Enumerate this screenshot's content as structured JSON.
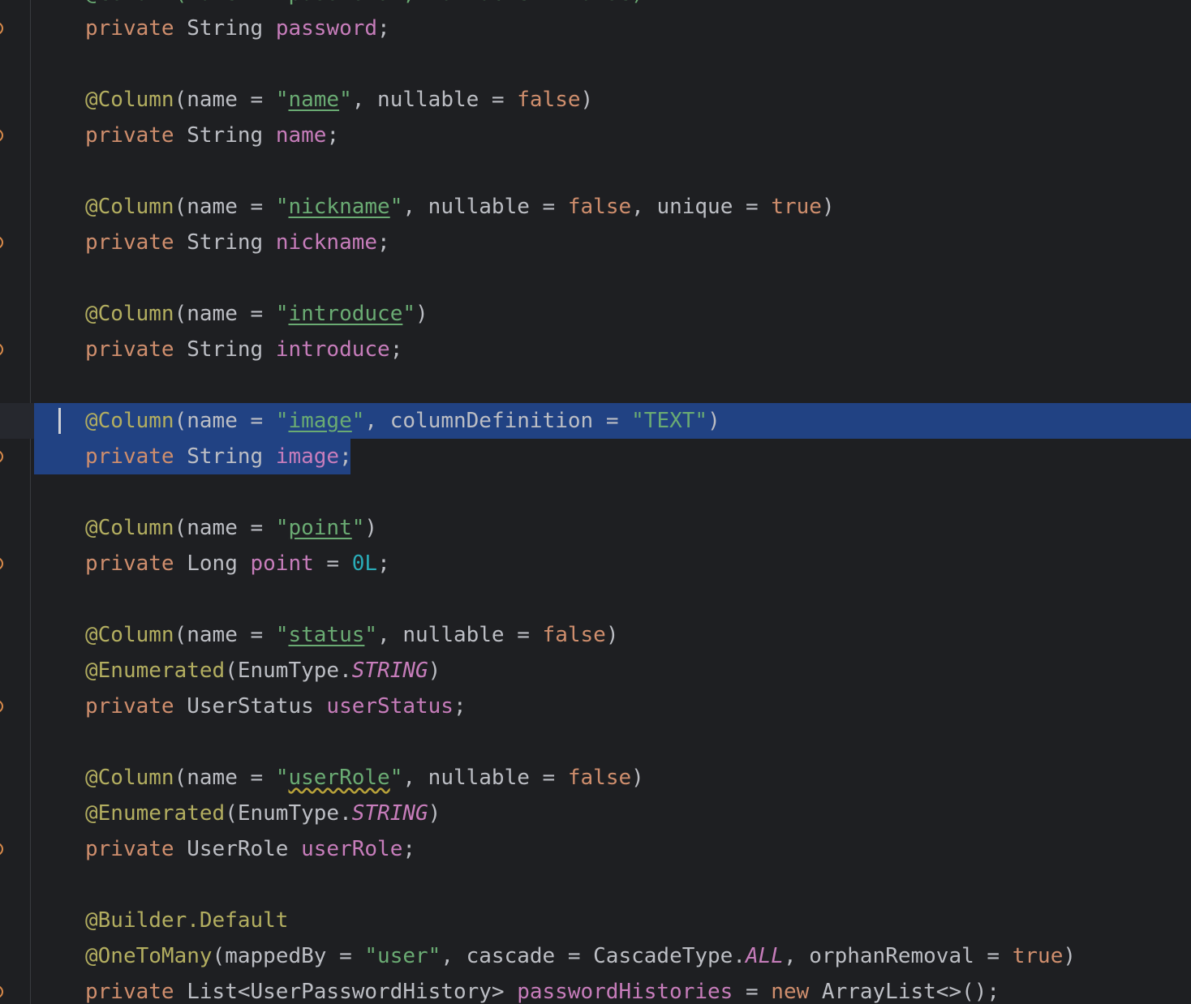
{
  "editor": {
    "language": "java",
    "lines": [
      [
        {
          "t": "private",
          "c": "kw"
        },
        {
          "t": " String ",
          "c": "plain"
        },
        {
          "t": "password",
          "c": "field"
        },
        {
          "t": ";",
          "c": "plain"
        }
      ],
      [],
      [
        {
          "t": "@Column",
          "c": "ann"
        },
        {
          "t": "(name = ",
          "c": "plain"
        },
        {
          "t": "\"",
          "c": "str"
        },
        {
          "t": "name",
          "c": "str",
          "u": "link"
        },
        {
          "t": "\"",
          "c": "str"
        },
        {
          "t": ", nullable = ",
          "c": "plain"
        },
        {
          "t": "false",
          "c": "kw"
        },
        {
          "t": ")",
          "c": "plain"
        }
      ],
      [
        {
          "t": "private",
          "c": "kw"
        },
        {
          "t": " String ",
          "c": "plain"
        },
        {
          "t": "name",
          "c": "field"
        },
        {
          "t": ";",
          "c": "plain"
        }
      ],
      [],
      [
        {
          "t": "@Column",
          "c": "ann"
        },
        {
          "t": "(name = ",
          "c": "plain"
        },
        {
          "t": "\"",
          "c": "str"
        },
        {
          "t": "nickname",
          "c": "str",
          "u": "link"
        },
        {
          "t": "\"",
          "c": "str"
        },
        {
          "t": ", nullable = ",
          "c": "plain"
        },
        {
          "t": "false",
          "c": "kw"
        },
        {
          "t": ", unique = ",
          "c": "plain"
        },
        {
          "t": "true",
          "c": "kw"
        },
        {
          "t": ")",
          "c": "plain"
        }
      ],
      [
        {
          "t": "private",
          "c": "kw"
        },
        {
          "t": " String ",
          "c": "plain"
        },
        {
          "t": "nickname",
          "c": "field"
        },
        {
          "t": ";",
          "c": "plain"
        }
      ],
      [],
      [
        {
          "t": "@Column",
          "c": "ann"
        },
        {
          "t": "(name = ",
          "c": "plain"
        },
        {
          "t": "\"",
          "c": "str"
        },
        {
          "t": "introduce",
          "c": "str",
          "u": "link"
        },
        {
          "t": "\"",
          "c": "str"
        },
        {
          "t": ")",
          "c": "plain"
        }
      ],
      [
        {
          "t": "private",
          "c": "kw"
        },
        {
          "t": " String ",
          "c": "plain"
        },
        {
          "t": "introduce",
          "c": "field"
        },
        {
          "t": ";",
          "c": "plain"
        }
      ],
      [],
      [
        {
          "t": "@Column",
          "c": "ann"
        },
        {
          "t": "(name = ",
          "c": "plain"
        },
        {
          "t": "\"",
          "c": "str"
        },
        {
          "t": "image",
          "c": "str",
          "u": "link"
        },
        {
          "t": "\"",
          "c": "str"
        },
        {
          "t": ", columnDefinition = ",
          "c": "plain"
        },
        {
          "t": "\"TEXT\"",
          "c": "str"
        },
        {
          "t": ")",
          "c": "plain"
        }
      ],
      [
        {
          "t": "private",
          "c": "kw"
        },
        {
          "t": " String ",
          "c": "plain"
        },
        {
          "t": "image",
          "c": "field"
        },
        {
          "t": ";",
          "c": "plain"
        }
      ],
      [],
      [
        {
          "t": "@Column",
          "c": "ann"
        },
        {
          "t": "(name = ",
          "c": "plain"
        },
        {
          "t": "\"",
          "c": "str"
        },
        {
          "t": "point",
          "c": "str",
          "u": "link"
        },
        {
          "t": "\"",
          "c": "str"
        },
        {
          "t": ")",
          "c": "plain"
        }
      ],
      [
        {
          "t": "private",
          "c": "kw"
        },
        {
          "t": " Long ",
          "c": "plain"
        },
        {
          "t": "point",
          "c": "field"
        },
        {
          "t": " = ",
          "c": "plain"
        },
        {
          "t": "0L",
          "c": "num"
        },
        {
          "t": ";",
          "c": "plain"
        }
      ],
      [],
      [
        {
          "t": "@Column",
          "c": "ann"
        },
        {
          "t": "(name = ",
          "c": "plain"
        },
        {
          "t": "\"",
          "c": "str"
        },
        {
          "t": "status",
          "c": "str",
          "u": "link"
        },
        {
          "t": "\"",
          "c": "str"
        },
        {
          "t": ", nullable = ",
          "c": "plain"
        },
        {
          "t": "false",
          "c": "kw"
        },
        {
          "t": ")",
          "c": "plain"
        }
      ],
      [
        {
          "t": "@Enumerated",
          "c": "ann"
        },
        {
          "t": "(EnumType.",
          "c": "plain"
        },
        {
          "t": "STRING",
          "c": "static"
        },
        {
          "t": ")",
          "c": "plain"
        }
      ],
      [
        {
          "t": "private",
          "c": "kw"
        },
        {
          "t": " UserStatus ",
          "c": "plain"
        },
        {
          "t": "userStatus",
          "c": "field"
        },
        {
          "t": ";",
          "c": "plain"
        }
      ],
      [],
      [
        {
          "t": "@Column",
          "c": "ann"
        },
        {
          "t": "(name = ",
          "c": "plain"
        },
        {
          "t": "\"",
          "c": "str"
        },
        {
          "t": "userRole",
          "c": "str",
          "u": "typo"
        },
        {
          "t": "\"",
          "c": "str"
        },
        {
          "t": ", nullable = ",
          "c": "plain"
        },
        {
          "t": "false",
          "c": "kw"
        },
        {
          "t": ")",
          "c": "plain"
        }
      ],
      [
        {
          "t": "@Enumerated",
          "c": "ann"
        },
        {
          "t": "(EnumType.",
          "c": "plain"
        },
        {
          "t": "STRING",
          "c": "static"
        },
        {
          "t": ")",
          "c": "plain"
        }
      ],
      [
        {
          "t": "private",
          "c": "kw"
        },
        {
          "t": " UserRole ",
          "c": "plain"
        },
        {
          "t": "userRole",
          "c": "field"
        },
        {
          "t": ";",
          "c": "plain"
        }
      ],
      [],
      [
        {
          "t": "@Builder.Default",
          "c": "ann"
        }
      ],
      [
        {
          "t": "@OneToMany",
          "c": "ann"
        },
        {
          "t": "(mappedBy = ",
          "c": "plain"
        },
        {
          "t": "\"user\"",
          "c": "str"
        },
        {
          "t": ", cascade = CascadeType.",
          "c": "plain"
        },
        {
          "t": "ALL",
          "c": "static"
        },
        {
          "t": ", orphanRemoval = ",
          "c": "plain"
        },
        {
          "t": "true",
          "c": "kw"
        },
        {
          "t": ")",
          "c": "plain"
        }
      ],
      [
        {
          "t": "private",
          "c": "kw"
        },
        {
          "t": " List<UserPasswordHistory> ",
          "c": "plain"
        },
        {
          "t": "passwordHistories",
          "c": "field"
        },
        {
          "t": " = ",
          "c": "plain"
        },
        {
          "t": "new",
          "c": "kw"
        },
        {
          "t": " ArrayList<>();",
          "c": "plain"
        }
      ]
    ],
    "marker_lines": [
      0,
      3,
      6,
      9,
      12,
      15,
      19,
      23,
      27
    ],
    "selection": {
      "full_line": 11,
      "partial_line": 12
    },
    "caret_line": 11
  },
  "colors": {
    "background": "#1e1f22",
    "keyword": "#cf8e6d",
    "annotation": "#b3ae60",
    "string": "#6aab73",
    "field": "#c77dbb",
    "number": "#2aacb8",
    "selection": "#214283"
  }
}
